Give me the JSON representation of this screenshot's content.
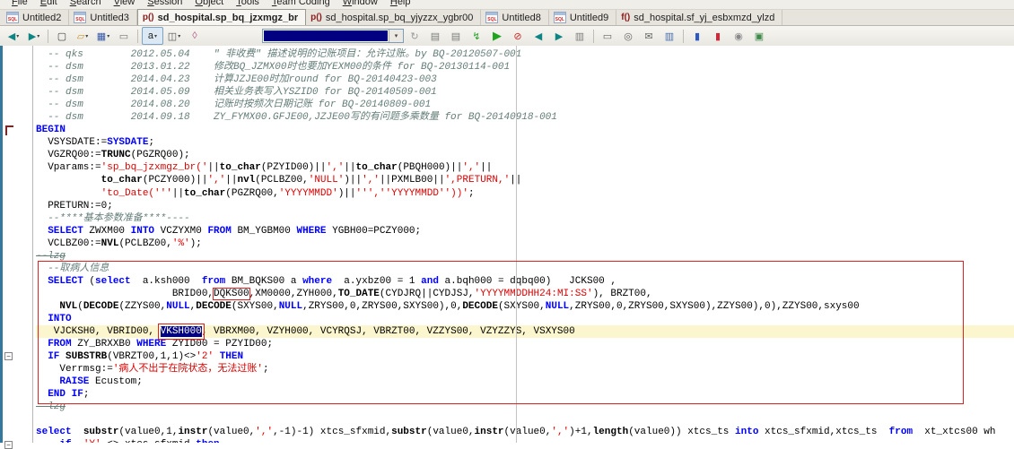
{
  "menu_bar": {
    "items": [
      "File",
      "Edit",
      "Search",
      "View",
      "Session",
      "Object",
      "Tools",
      "Team Coding",
      "Window",
      "Help"
    ]
  },
  "tab_bar": {
    "icon_labels": {
      "sql": "SQL",
      "proc": "p()",
      "func": "f()"
    },
    "tabs": [
      {
        "label": "Untitled2",
        "icon": "sql",
        "active": false
      },
      {
        "label": "Untitled3",
        "icon": "sql",
        "active": false
      },
      {
        "label": "sd_hospital.sp_bq_jzxmgz_br",
        "icon": "proc",
        "active": true
      },
      {
        "label": "sd_hospital.sp_bq_yjyzzx_ygbr00",
        "icon": "proc",
        "active": false
      },
      {
        "label": "Untitled8",
        "icon": "sql",
        "active": false
      },
      {
        "label": "Untitled9",
        "icon": "sql",
        "active": false
      },
      {
        "label": "sd_hospital.sf_yj_esbxmzd_ylzd",
        "icon": "func",
        "active": false
      }
    ]
  },
  "toolbar": {
    "items": [
      {
        "type": "button",
        "name": "back-button",
        "glyph": "◀",
        "color": "#0e8585",
        "caret": true
      },
      {
        "type": "button",
        "name": "forward-button",
        "glyph": "▶",
        "color": "#0e8585",
        "caret": true
      },
      {
        "type": "sep"
      },
      {
        "type": "button",
        "name": "new-file-button",
        "glyph": "▢",
        "color": "#444444"
      },
      {
        "type": "button",
        "name": "open-file-button",
        "glyph": "▱",
        "color": "#c9972f",
        "caret": true
      },
      {
        "type": "button",
        "name": "save-button",
        "glyph": "▦",
        "color": "#3558a8",
        "caret": true
      },
      {
        "type": "button",
        "name": "print-button",
        "glyph": "▭",
        "color": "#777777"
      },
      {
        "type": "sep"
      },
      {
        "type": "button",
        "name": "highlight-toggle-button",
        "glyph": "a",
        "color": "#222222",
        "pressed": true,
        "caret": true
      },
      {
        "type": "button",
        "name": "window-layout-button",
        "glyph": "◫",
        "color": "#555555",
        "caret": true
      },
      {
        "type": "button",
        "name": "clear-button",
        "glyph": "◊",
        "color": "#b05c8a"
      },
      {
        "type": "space",
        "width": 62
      },
      {
        "type": "combo",
        "name": "sql-recall-combobox",
        "value": ""
      },
      {
        "type": "button",
        "name": "refresh-button",
        "glyph": "↻",
        "color": "#999999"
      },
      {
        "type": "button",
        "name": "describe-button",
        "glyph": "▤",
        "color": "#7c7c7c"
      },
      {
        "type": "button",
        "name": "script-button",
        "glyph": "▤",
        "color": "#7c7c7c"
      },
      {
        "type": "button",
        "name": "run-script-button",
        "glyph": "↯",
        "color": "#28a02a"
      },
      {
        "type": "button",
        "name": "execute-button",
        "glyph": "▶",
        "color": "#1fa41f",
        "big": true
      },
      {
        "type": "button",
        "name": "stop-button",
        "glyph": "⊘",
        "color": "#cf2a2a"
      },
      {
        "type": "button",
        "name": "previous-statement-button",
        "glyph": "◀",
        "color": "#0e8585"
      },
      {
        "type": "button",
        "name": "next-statement-button",
        "glyph": "▶",
        "color": "#0e8585"
      },
      {
        "type": "button",
        "name": "compile-button",
        "glyph": "▥",
        "color": "#7c7c7c"
      },
      {
        "type": "sep"
      },
      {
        "type": "button",
        "name": "printer-button",
        "glyph": "▭",
        "color": "#666666"
      },
      {
        "type": "button",
        "name": "print-preview-button",
        "glyph": "◎",
        "color": "#666666"
      },
      {
        "type": "button",
        "name": "email-button",
        "glyph": "✉",
        "color": "#666666"
      },
      {
        "type": "button",
        "name": "export-button",
        "glyph": "▥",
        "color": "#4a6fb0"
      },
      {
        "type": "sep"
      },
      {
        "type": "button",
        "name": "team-checkout-button",
        "glyph": "▮",
        "color": "#2b59c9"
      },
      {
        "type": "button",
        "name": "team-checkin-button",
        "glyph": "▮",
        "color": "#c92b3b"
      },
      {
        "type": "button",
        "name": "team-lock-button",
        "glyph": "◉",
        "color": "#8a8a8a"
      },
      {
        "type": "button",
        "name": "team-browser-button",
        "glyph": "▣",
        "color": "#3f8a4a"
      }
    ]
  },
  "editor": {
    "colors": {
      "keyword": "#0000ff",
      "string": "#dd0000",
      "comment": "#637d77",
      "current_line": "#fbf6cd",
      "selection_bg": "#000080",
      "annotation": "#dd2222"
    },
    "right_margin_column": 81,
    "red_box": {
      "from_line": 17,
      "to_line": 27
    },
    "gutter_markers": [
      {
        "line": 6,
        "type": "begin-bracket"
      },
      {
        "line": 24,
        "type": "fold-collapse"
      },
      {
        "line": 31,
        "type": "fold-collapse"
      }
    ],
    "fold_glyph": "−",
    "lines": [
      {
        "tokens": [
          {
            "t": "  -- qks        2012.05.04    \" 非收费\" 描述说明的记账项目：允许过账。by BQ-20120507-001",
            "c": "cm"
          }
        ]
      },
      {
        "tokens": [
          {
            "t": "  -- dsm        2013.01.22    修改BQ_JZMX00时也要加YEXM00的条件 for BQ-20130114-001",
            "c": "cm"
          }
        ]
      },
      {
        "tokens": [
          {
            "t": "  -- dsm        2014.04.23    计算JZJE00时加round for BQ-20140423-003",
            "c": "cm"
          }
        ]
      },
      {
        "tokens": [
          {
            "t": "  -- dsm        2014.05.09    相关业务表写入YSZID0 for BQ-20140509-001",
            "c": "cm"
          }
        ]
      },
      {
        "tokens": [
          {
            "t": "  -- dsm        2014.08.20    记账时按频次日期记账 for BQ-20140809-001",
            "c": "cm"
          }
        ]
      },
      {
        "tokens": [
          {
            "t": "  -- dsm        2014.09.18    ZY_FYMX00.GFJE00,JZJE00写的有问题多乘数量 for BQ-20140918-001",
            "c": "cm"
          }
        ]
      },
      {
        "tokens": [
          {
            "t": "BEGIN",
            "c": "kw"
          }
        ]
      },
      {
        "tokens": [
          {
            "t": "  VSYSDATE:=",
            "c": "id"
          },
          {
            "t": "SYSDATE",
            "c": "kw"
          },
          {
            "t": ";",
            "c": "id"
          }
        ]
      },
      {
        "tokens": [
          {
            "t": "  VGZRQ00:=",
            "c": "id"
          },
          {
            "t": "TRUNC",
            "c": "fn"
          },
          {
            "t": "(PGZRQ00);",
            "c": "id"
          }
        ]
      },
      {
        "tokens": [
          {
            "t": "  Vparams:=",
            "c": "id"
          },
          {
            "t": "'sp_bq_jzxmgz_br('",
            "c": "str"
          },
          {
            "t": "||",
            "c": "id"
          },
          {
            "t": "to_char",
            "c": "fn"
          },
          {
            "t": "(PZYID00)||",
            "c": "id"
          },
          {
            "t": "','",
            "c": "str"
          },
          {
            "t": "||",
            "c": "id"
          },
          {
            "t": "to_char",
            "c": "fn"
          },
          {
            "t": "(PBQH000)||",
            "c": "id"
          },
          {
            "t": "','",
            "c": "str"
          },
          {
            "t": "||",
            "c": "id"
          }
        ]
      },
      {
        "tokens": [
          {
            "t": "           ",
            "c": "id"
          },
          {
            "t": "to_char",
            "c": "fn"
          },
          {
            "t": "(PCZY000)||",
            "c": "id"
          },
          {
            "t": "','",
            "c": "str"
          },
          {
            "t": "||",
            "c": "id"
          },
          {
            "t": "nvl",
            "c": "fn"
          },
          {
            "t": "(PCLBZ00,",
            "c": "id"
          },
          {
            "t": "'NULL'",
            "c": "str"
          },
          {
            "t": ")||",
            "c": "id"
          },
          {
            "t": "','",
            "c": "str"
          },
          {
            "t": "||PXMLB00||",
            "c": "id"
          },
          {
            "t": "',PRETURN,'",
            "c": "str"
          },
          {
            "t": "||",
            "c": "id"
          }
        ]
      },
      {
        "tokens": [
          {
            "t": "           ",
            "c": "id"
          },
          {
            "t": "'to_Date('''",
            "c": "str"
          },
          {
            "t": "||",
            "c": "id"
          },
          {
            "t": "to_char",
            "c": "fn"
          },
          {
            "t": "(PGZRQ00,",
            "c": "id"
          },
          {
            "t": "'YYYYMMDD'",
            "c": "str"
          },
          {
            "t": ")||",
            "c": "id"
          },
          {
            "t": "''',''YYYYMMDD''))'",
            "c": "str"
          },
          {
            "t": ";",
            "c": "id"
          }
        ]
      },
      {
        "tokens": [
          {
            "t": "  PRETURN:=",
            "c": "id"
          },
          {
            "t": "0",
            "c": "num"
          },
          {
            "t": ";",
            "c": "id"
          }
        ]
      },
      {
        "tokens": [
          {
            "t": "  --****基本参数准备****----",
            "c": "cm"
          }
        ]
      },
      {
        "tokens": [
          {
            "t": "  ",
            "c": "id"
          },
          {
            "t": "SELECT",
            "c": "kw"
          },
          {
            "t": " ZWXM00 ",
            "c": "id"
          },
          {
            "t": "INTO",
            "c": "kw"
          },
          {
            "t": " VCZYXM0 ",
            "c": "id"
          },
          {
            "t": "FROM",
            "c": "kw"
          },
          {
            "t": " BM_YGBM00 ",
            "c": "id"
          },
          {
            "t": "WHERE",
            "c": "kw"
          },
          {
            "t": " YGBH00=PCZY000;",
            "c": "id"
          }
        ]
      },
      {
        "tokens": [
          {
            "t": "  VCLBZ00:=",
            "c": "id"
          },
          {
            "t": "NVL",
            "c": "fn"
          },
          {
            "t": "(PCLBZ00,",
            "c": "id"
          },
          {
            "t": "'%'",
            "c": "str"
          },
          {
            "t": ");",
            "c": "id"
          }
        ]
      },
      {
        "tokens": [
          {
            "t": "--lzg",
            "c": "cm",
            "m": "strike"
          }
        ]
      },
      {
        "tokens": [
          {
            "t": "  --取病人信息",
            "c": "cm"
          }
        ]
      },
      {
        "tokens": [
          {
            "t": "  ",
            "c": "id"
          },
          {
            "t": "SELECT",
            "c": "kw"
          },
          {
            "t": " (",
            "c": "id"
          },
          {
            "t": "select",
            "c": "kw"
          },
          {
            "t": "  a.ksh000  ",
            "c": "id"
          },
          {
            "t": "from",
            "c": "kw"
          },
          {
            "t": " BM_BQKS00 a ",
            "c": "id"
          },
          {
            "t": "where",
            "c": "kw"
          },
          {
            "t": "  a.yxbz00 = ",
            "c": "id"
          },
          {
            "t": "1",
            "c": "num"
          },
          {
            "t": " ",
            "c": "id"
          },
          {
            "t": "and",
            "c": "kw"
          },
          {
            "t": " a.bqh000 = dqbq00)   JCKS00 ,",
            "c": "id"
          }
        ]
      },
      {
        "tokens": [
          {
            "t": "                       BRID00,",
            "c": "id"
          },
          {
            "t": "DQKS00",
            "c": "id",
            "m": "redbox"
          },
          {
            "t": ",XM0000,ZYH000,",
            "c": "id"
          },
          {
            "t": "TO_DATE",
            "c": "fn"
          },
          {
            "t": "(CYDJRQ||CYDJSJ,",
            "c": "id"
          },
          {
            "t": "'YYYYMMDDHH24:MI:SS'",
            "c": "str"
          },
          {
            "t": "), BRZT00,",
            "c": "id"
          }
        ]
      },
      {
        "tokens": [
          {
            "t": "    ",
            "c": "id"
          },
          {
            "t": "NVL",
            "c": "fn"
          },
          {
            "t": "(",
            "c": "id"
          },
          {
            "t": "DECODE",
            "c": "fn"
          },
          {
            "t": "(ZZYS00,",
            "c": "id"
          },
          {
            "t": "NULL",
            "c": "kw"
          },
          {
            "t": ",",
            "c": "id"
          },
          {
            "t": "DECODE",
            "c": "fn"
          },
          {
            "t": "(SXYS00,",
            "c": "id"
          },
          {
            "t": "NULL",
            "c": "kw"
          },
          {
            "t": ",ZRYS00,0,ZRYS00,SXYS00),0,",
            "c": "id"
          },
          {
            "t": "DECODE",
            "c": "fn"
          },
          {
            "t": "(SXYS00,",
            "c": "id"
          },
          {
            "t": "NULL",
            "c": "kw"
          },
          {
            "t": ",ZRYS00,0,ZRYS00,SXYS00),ZZYS00),0),ZZYS00,sxys00",
            "c": "id"
          }
        ]
      },
      {
        "tokens": [
          {
            "t": "  ",
            "c": "id"
          },
          {
            "t": "INTO",
            "c": "kw"
          }
        ]
      },
      {
        "hl": true,
        "tokens": [
          {
            "t": "   VJCKSH0, VBRID00, ",
            "c": "id"
          },
          {
            "t": "VKSH000",
            "c": "id",
            "m": "sel"
          },
          {
            "t": ", VBRXM00, VZYH000, VCYRQSJ, VBRZT00, VZZYS00, VZYZZYS, VSXYS00",
            "c": "id"
          }
        ]
      },
      {
        "tokens": [
          {
            "t": "  ",
            "c": "id"
          },
          {
            "t": "FROM",
            "c": "kw"
          },
          {
            "t": " ZY_BRXXB0 ",
            "c": "id"
          },
          {
            "t": "WHERE",
            "c": "kw"
          },
          {
            "t": " ZYID00 = PZYID00;",
            "c": "id"
          }
        ]
      },
      {
        "tokens": [
          {
            "t": "  ",
            "c": "id"
          },
          {
            "t": "IF",
            "c": "kw"
          },
          {
            "t": " ",
            "c": "id"
          },
          {
            "t": "SUBSTRB",
            "c": "fn"
          },
          {
            "t": "(VBRZT00,1,1)<>",
            "c": "id"
          },
          {
            "t": "'2'",
            "c": "str"
          },
          {
            "t": " ",
            "c": "id"
          },
          {
            "t": "THEN",
            "c": "kw"
          }
        ]
      },
      {
        "tokens": [
          {
            "t": "    Verrmsg:=",
            "c": "id"
          },
          {
            "t": "'病人不出于在院状态，无法过账'",
            "c": "str"
          },
          {
            "t": ";",
            "c": "id"
          }
        ]
      },
      {
        "tokens": [
          {
            "t": "    ",
            "c": "id"
          },
          {
            "t": "RAISE",
            "c": "kw"
          },
          {
            "t": " Ecustom;",
            "c": "id"
          }
        ]
      },
      {
        "tokens": [
          {
            "t": "  ",
            "c": "id"
          },
          {
            "t": "END IF",
            "c": "kw"
          },
          {
            "t": ";",
            "c": "id"
          }
        ]
      },
      {
        "tokens": [
          {
            "t": "  lzg",
            "c": "cm",
            "m": "strike"
          }
        ]
      },
      {
        "tokens": []
      },
      {
        "tokens": [
          {
            "t": "select",
            "c": "kw"
          },
          {
            "t": "  ",
            "c": "id"
          },
          {
            "t": "substr",
            "c": "fn"
          },
          {
            "t": "(value0,1,",
            "c": "id"
          },
          {
            "t": "instr",
            "c": "fn"
          },
          {
            "t": "(value0,",
            "c": "id"
          },
          {
            "t": "','",
            "c": "str"
          },
          {
            "t": ",-1)-1) xtcs_sfxmid,",
            "c": "id"
          },
          {
            "t": "substr",
            "c": "fn"
          },
          {
            "t": "(value0,",
            "c": "id"
          },
          {
            "t": "instr",
            "c": "fn"
          },
          {
            "t": "(value0,",
            "c": "id"
          },
          {
            "t": "','",
            "c": "str"
          },
          {
            "t": ")+1,",
            "c": "id"
          },
          {
            "t": "length",
            "c": "fn"
          },
          {
            "t": "(value0)) xtcs_ts ",
            "c": "id"
          },
          {
            "t": "into",
            "c": "kw"
          },
          {
            "t": " xtcs_sfxmid,xtcs_ts  ",
            "c": "id"
          },
          {
            "t": "from",
            "c": "kw"
          },
          {
            "t": "  xt_xtcs00 wh",
            "c": "id"
          }
        ]
      },
      {
        "tokens": [
          {
            "t": "    ",
            "c": "id"
          },
          {
            "t": "if",
            "c": "kw"
          },
          {
            "t": "  ",
            "c": "id"
          },
          {
            "t": "'Y'",
            "c": "str"
          },
          {
            "t": " <> xtcs_sfxmid ",
            "c": "id"
          },
          {
            "t": "then",
            "c": "kw"
          }
        ]
      }
    ]
  }
}
